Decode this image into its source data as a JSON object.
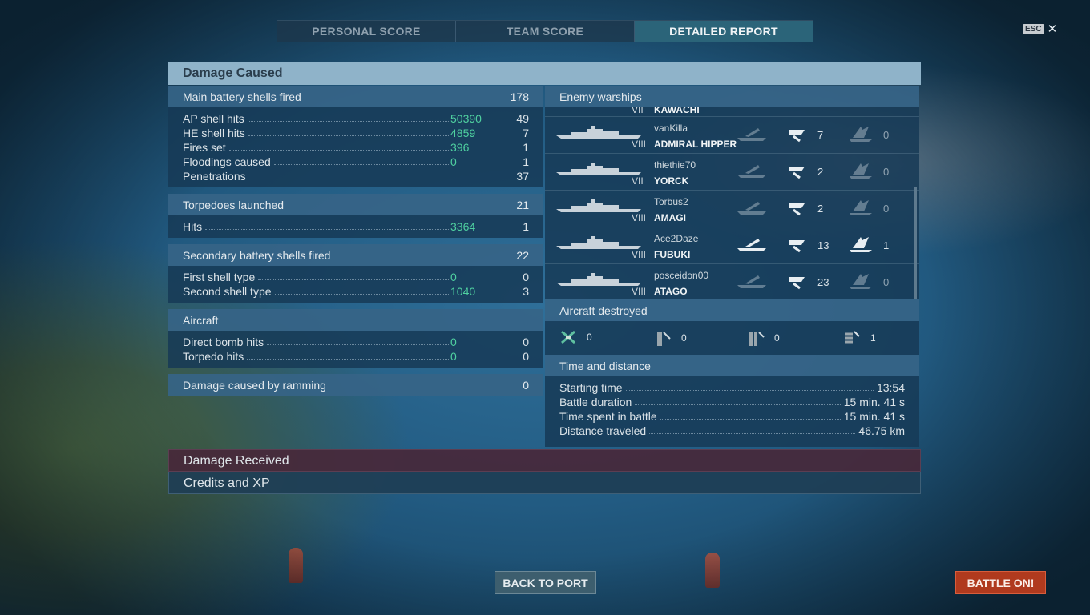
{
  "tabs": [
    "PERSONAL SCORE",
    "TEAM SCORE",
    "DETAILED REPORT"
  ],
  "esc": {
    "key": "ESC",
    "close": "✕"
  },
  "damage": {
    "title": "Damage Caused",
    "main": {
      "label": "Main battery shells fired",
      "value": "178",
      "rows": [
        {
          "label": "AP shell hits",
          "dmg": "50390",
          "value": "49"
        },
        {
          "label": "HE shell hits",
          "dmg": "4859",
          "value": "7"
        },
        {
          "label": "Fires set",
          "dmg": "396",
          "value": "1"
        },
        {
          "label": "Floodings caused",
          "dmg": "0",
          "value": "1"
        },
        {
          "label": "Penetrations",
          "dmg": "",
          "value": "37"
        }
      ]
    },
    "torp": {
      "label": "Torpedoes launched",
      "value": "21",
      "rows": [
        {
          "label": "Hits",
          "dmg": "3364",
          "value": "1"
        }
      ]
    },
    "secondary": {
      "label": "Secondary battery shells fired",
      "value": "22",
      "rows": [
        {
          "label": "First shell type",
          "dmg": "0",
          "value": "0"
        },
        {
          "label": "Second shell type",
          "dmg": "1040",
          "value": "3"
        }
      ]
    },
    "aircraft": {
      "label": "Aircraft",
      "rows": [
        {
          "label": "Direct bomb hits",
          "dmg": "0",
          "value": "0"
        },
        {
          "label": "Torpedo hits",
          "dmg": "0",
          "value": "0"
        }
      ]
    },
    "ram": {
      "label": "Damage caused by ramming",
      "value": "0"
    }
  },
  "enemy": {
    "title": "Enemy warships",
    "partial": {
      "tier": "VII",
      "name": "KAWACHI"
    },
    "ships": [
      {
        "player": "vanKilla",
        "tier": "VIII",
        "name": "ADMIRAL HIPPER",
        "hits": "7",
        "kills": "0"
      },
      {
        "player": "thiethie70",
        "tier": "VII",
        "name": "YORCK",
        "hits": "2",
        "kills": "0"
      },
      {
        "player": "Torbus2",
        "tier": "VIII",
        "name": "AMAGI",
        "hits": "2",
        "kills": "0"
      },
      {
        "player": "Ace2Daze",
        "tier": "VIII",
        "name": "FUBUKI",
        "hits": "13",
        "kills": "1"
      },
      {
        "player": "posceidon00",
        "tier": "VIII",
        "name": "ATAGO",
        "hits": "23",
        "kills": "0"
      }
    ]
  },
  "aircraft_destroyed": {
    "title": "Aircraft destroyed",
    "values": [
      "0",
      "0",
      "0",
      "1"
    ]
  },
  "time": {
    "title": "Time and distance",
    "rows": [
      {
        "label": "Starting time",
        "value": "13:54"
      },
      {
        "label": "Battle duration",
        "value": "15 min. 41 s"
      },
      {
        "label": "Time spent in battle",
        "value": "15 min. 41 s"
      },
      {
        "label": "Distance traveled",
        "value": "46.75 km"
      }
    ]
  },
  "bottom": {
    "received": "Damage Received",
    "credits": "Credits and XP"
  },
  "buttons": {
    "back": "BACK TO PORT",
    "battle": "BATTLE ON!"
  }
}
